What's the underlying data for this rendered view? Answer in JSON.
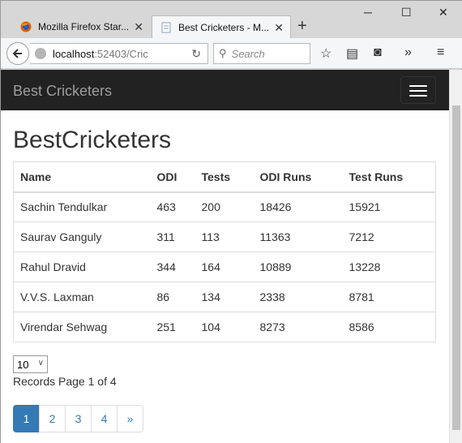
{
  "browser": {
    "tabs": [
      {
        "label": "Mozilla Firefox Star...",
        "active": false
      },
      {
        "label": "Best Cricketers - M...",
        "active": true
      }
    ],
    "new_tab_icon": "plus-icon",
    "window_controls": {
      "minimize": "─",
      "maximize": "☐",
      "close": "✕"
    },
    "url_host": "localhost",
    "url_path": ":52403/Cric",
    "search_placeholder": "Search"
  },
  "navbar": {
    "brand": "Best Cricketers"
  },
  "page": {
    "title": "BestCricketers"
  },
  "table": {
    "headers": [
      "Name",
      "ODI",
      "Tests",
      "ODI Runs",
      "Test Runs"
    ],
    "rows": [
      [
        "Sachin Tendulkar",
        "463",
        "200",
        "18426",
        "15921"
      ],
      [
        "Saurav Ganguly",
        "311",
        "113",
        "11363",
        "7212"
      ],
      [
        "Rahul Dravid",
        "344",
        "164",
        "10889",
        "13228"
      ],
      [
        "V.V.S. Laxman",
        "86",
        "134",
        "2338",
        "8781"
      ],
      [
        "Virendar Sehwag",
        "251",
        "104",
        "8273",
        "8586"
      ]
    ]
  },
  "pagesize": {
    "selected": "10"
  },
  "records_text": "Records Page 1 of 4",
  "pager": {
    "pages": [
      "1",
      "2",
      "3",
      "4",
      "»"
    ],
    "active_index": 0
  },
  "colors": {
    "navbar_bg": "#222222",
    "accent": "#337ab7"
  }
}
